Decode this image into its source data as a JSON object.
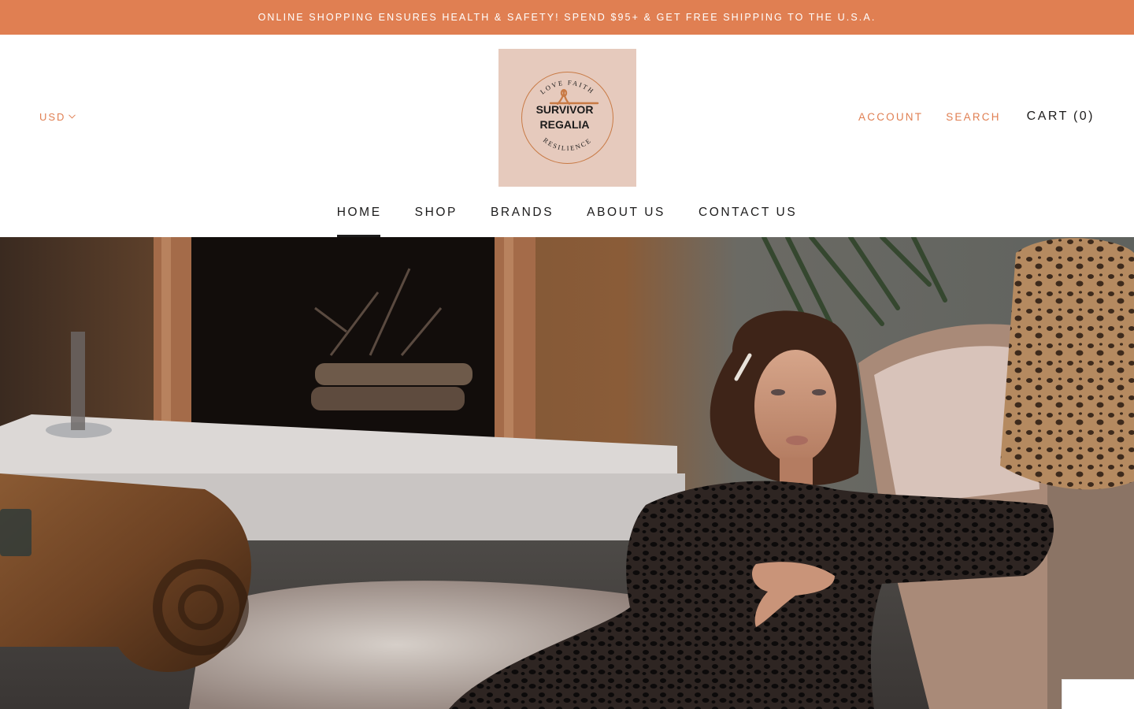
{
  "announcement": {
    "text": "ONLINE SHOPPING ENSURES HEALTH & SAFETY! SPEND $95+ & GET FREE SHIPPING TO THE U.S.A."
  },
  "header": {
    "currency": "USD",
    "logo": {
      "arc_top": "LOVE FAITH",
      "line1": "SURVIVOR",
      "line2": "REGALIA",
      "arc_bottom": "RESILIENCE",
      "background": "#e6cabd",
      "accent": "#c87a45"
    },
    "account_label": "ACCOUNT",
    "search_label": "SEARCH",
    "cart_label": "CART",
    "cart_count": "(0)"
  },
  "nav": {
    "items": [
      {
        "label": "HOME",
        "active": true
      },
      {
        "label": "SHOP"
      },
      {
        "label": "BRANDS"
      },
      {
        "label": "ABOUT US"
      },
      {
        "label": "CONTACT US"
      }
    ]
  },
  "colors": {
    "accent": "#e07f52",
    "text": "#1c1b1b",
    "logo_bg": "#e6cabd"
  },
  "icons": {
    "currency_dropdown": "chevron-down-icon"
  }
}
